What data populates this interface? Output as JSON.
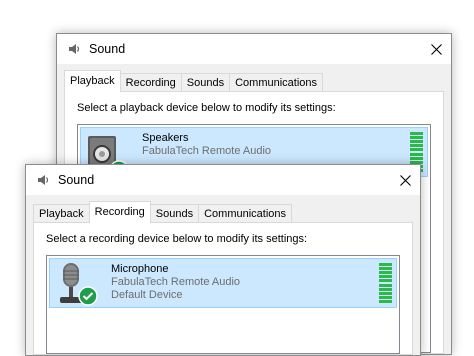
{
  "colors": {
    "selection": "#cce8ff",
    "level_meter": "#2db84a",
    "check_badge": "#1e9e4a"
  },
  "back_window": {
    "title": "Sound",
    "tabs": [
      {
        "label": "Playback",
        "active": true
      },
      {
        "label": "Recording",
        "active": false
      },
      {
        "label": "Sounds",
        "active": false
      },
      {
        "label": "Communications",
        "active": false
      }
    ],
    "instruction": "Select a playback device below to modify its settings:",
    "device": {
      "name": "Speakers",
      "driver": "FabulaTech Remote Audio",
      "icon": "speaker-icon",
      "status_icon": "check-icon"
    }
  },
  "front_window": {
    "title": "Sound",
    "tabs": [
      {
        "label": "Playback",
        "active": false
      },
      {
        "label": "Recording",
        "active": true
      },
      {
        "label": "Sounds",
        "active": false
      },
      {
        "label": "Communications",
        "active": false
      }
    ],
    "instruction": "Select a recording device below to modify its settings:",
    "device": {
      "name": "Microphone",
      "driver": "FabulaTech Remote Audio",
      "status": "Default Device",
      "icon": "microphone-icon",
      "status_icon": "check-icon"
    }
  }
}
